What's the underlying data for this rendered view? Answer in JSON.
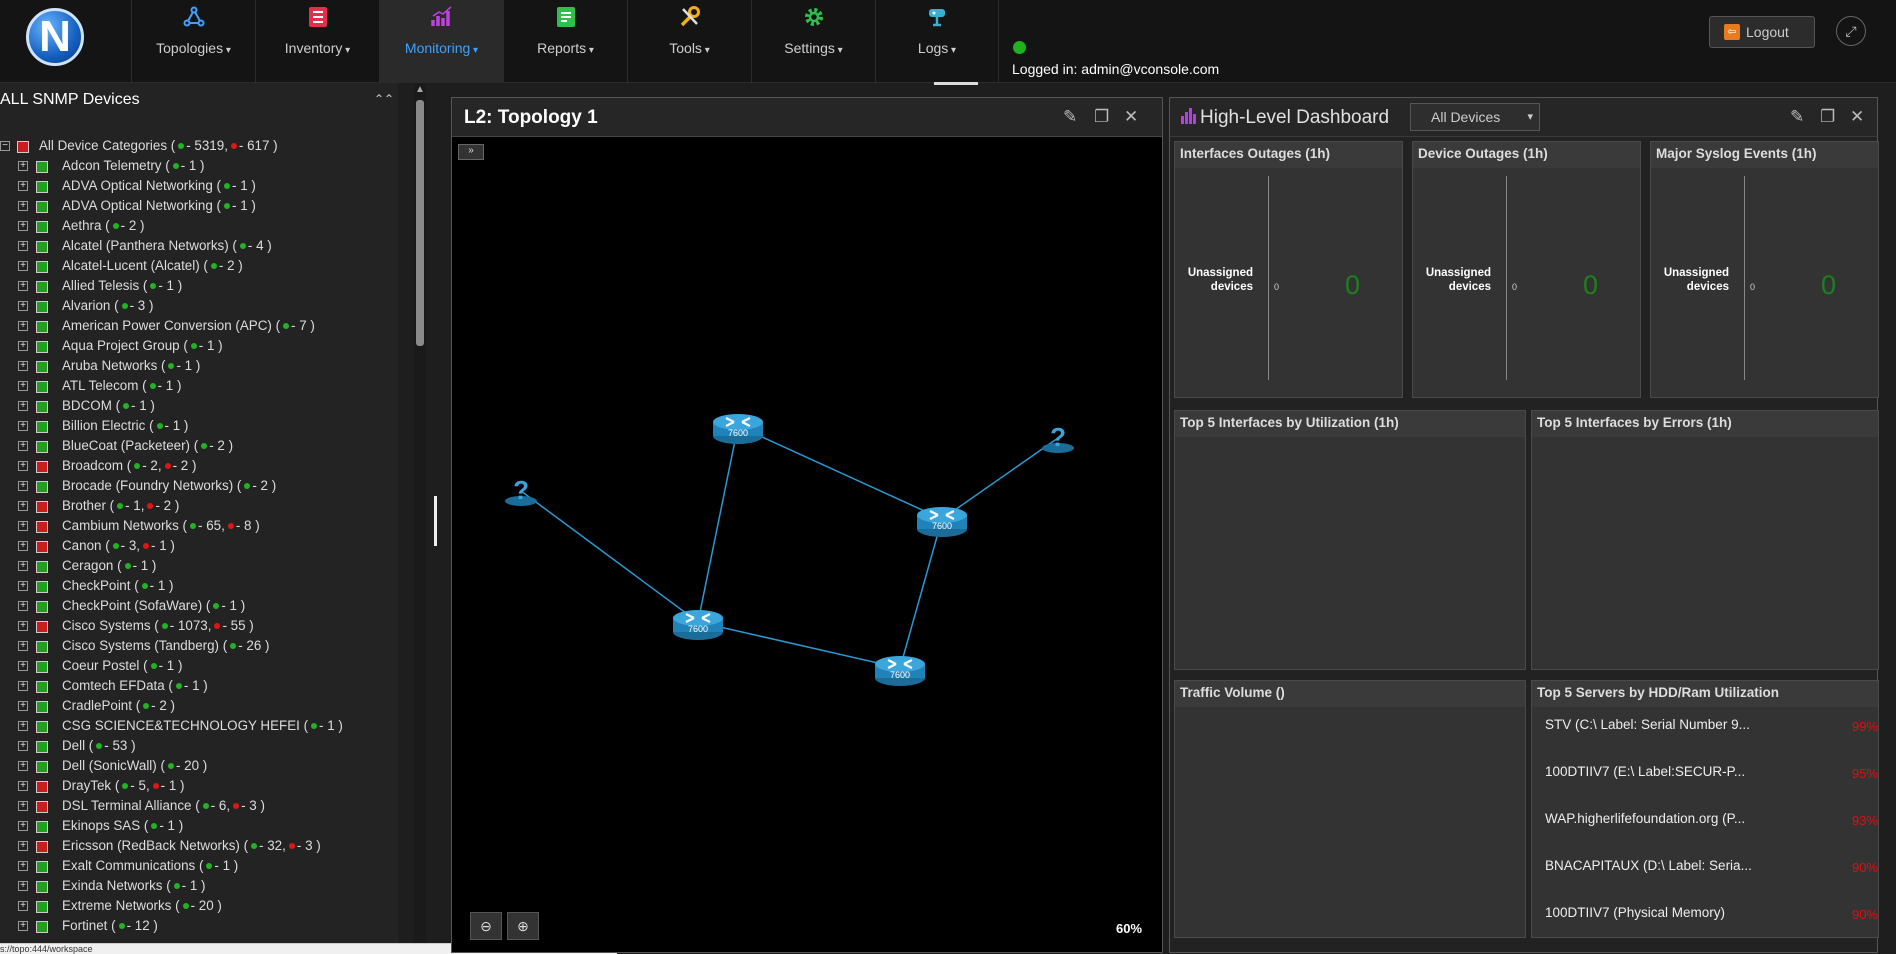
{
  "nav": {
    "items": [
      {
        "label": "Topologies",
        "icon": "topology-icon",
        "color": "#3ea1ff"
      },
      {
        "label": "Inventory",
        "icon": "inventory-icon",
        "color": "#e0304a"
      },
      {
        "label": "Monitoring",
        "icon": "monitoring-icon",
        "color": "#c040e0"
      },
      {
        "label": "Reports",
        "icon": "reports-icon",
        "color": "#2ec04a"
      },
      {
        "label": "Tools",
        "icon": "tools-icon",
        "color": "#f0b010"
      },
      {
        "label": "Settings",
        "icon": "settings-icon",
        "color": "#2ec04a"
      },
      {
        "label": "Logs",
        "icon": "logs-icon",
        "color": "#3ab0d0"
      }
    ],
    "active": "Monitoring",
    "logged_in": "Logged in: admin@vconsole.com",
    "logout": "Logout",
    "logo_letter": "N"
  },
  "devices": {
    "title": "ALL SNMP Devices",
    "root": {
      "label": "All Device Categories",
      "green": "5319",
      "red": "617"
    },
    "items": [
      {
        "label": "Adcon Telemetry",
        "green": "1"
      },
      {
        "label": "ADVA Optical Networking",
        "green": "1"
      },
      {
        "label": "ADVA Optical Networking",
        "green": "1"
      },
      {
        "label": "Aethra",
        "green": "2"
      },
      {
        "label": "Alcatel (Panthera Networks)",
        "green": "4"
      },
      {
        "label": "Alcatel-Lucent (Alcatel)",
        "green": "2"
      },
      {
        "label": "Allied Telesis",
        "green": "1"
      },
      {
        "label": "Alvarion",
        "green": "3"
      },
      {
        "label": "American Power Conversion (APC)",
        "green": "7"
      },
      {
        "label": "Aqua Project Group",
        "green": "1"
      },
      {
        "label": "Aruba Networks",
        "green": "1"
      },
      {
        "label": "ATL Telecom",
        "green": "1"
      },
      {
        "label": "BDCOM",
        "green": "1"
      },
      {
        "label": "Billion Electric",
        "green": "1"
      },
      {
        "label": "BlueCoat (Packeteer)",
        "green": "2"
      },
      {
        "label": "Broadcom",
        "green": "2",
        "red": "2"
      },
      {
        "label": "Brocade (Foundry Networks)",
        "green": "2"
      },
      {
        "label": "Brother",
        "green": "1",
        "red": "2"
      },
      {
        "label": "Cambium Networks",
        "green": "65",
        "red": "8"
      },
      {
        "label": "Canon",
        "green": "3",
        "red": "1"
      },
      {
        "label": "Ceragon",
        "green": "1"
      },
      {
        "label": "CheckPoint",
        "green": "1"
      },
      {
        "label": "CheckPoint (SofaWare)",
        "green": "1"
      },
      {
        "label": "Cisco Systems",
        "green": "1073",
        "red": "55"
      },
      {
        "label": "Cisco Systems (Tandberg)",
        "green": "26"
      },
      {
        "label": "Coeur Postel",
        "green": "1"
      },
      {
        "label": "Comtech EFData",
        "green": "1"
      },
      {
        "label": "CradlePoint",
        "green": "2"
      },
      {
        "label": "CSG SCIENCE&TECHNOLOGY HEFEI",
        "green": "1"
      },
      {
        "label": "Dell",
        "green": "53"
      },
      {
        "label": "Dell (SonicWall)",
        "green": "20"
      },
      {
        "label": "DrayTek",
        "green": "5",
        "red": "1"
      },
      {
        "label": "DSL Terminal Alliance",
        "green": "6",
        "red": "3"
      },
      {
        "label": "Ekinops SAS",
        "green": "1"
      },
      {
        "label": "Ericsson (RedBack Networks)",
        "green": "32",
        "red": "3"
      },
      {
        "label": "Exalt Communications",
        "green": "1"
      },
      {
        "label": "Exinda Networks",
        "green": "1"
      },
      {
        "label": "Extreme Networks",
        "green": "20"
      },
      {
        "label": "Fortinet",
        "green": "12"
      }
    ]
  },
  "status_url": "s://topo:444/workspace",
  "topology": {
    "title": "L2: Topology 1",
    "zoom": "60%",
    "expand": "»",
    "model_label": "7600"
  },
  "dashboard": {
    "title": "High-Level Dashboard",
    "filter": "All Devices",
    "cards": {
      "interfaces_outages": "Interfaces Outages (1h)",
      "device_outages": "Device Outages (1h)",
      "major_syslog": "Major Syslog Events (1h)",
      "top5_util": "Top 5 Interfaces by Utilization (1h)",
      "top5_errors": "Top 5 Interfaces by Errors (1h)",
      "traffic_volume": "Traffic Volume ()",
      "top5_servers": "Top 5 Servers by HDD/Ram Utilization"
    },
    "outage": {
      "label": "Unassigned devices",
      "axis_zero": "0",
      "value": "0"
    },
    "servers": [
      {
        "name": "STV (C:\\ Label: Serial Number 9...",
        "pct": "99%"
      },
      {
        "name": "100DTIIV7 (E:\\ Label:SECUR-P...",
        "pct": "95%"
      },
      {
        "name": "WAP.higherlifefoundation.org (P...",
        "pct": "93%"
      },
      {
        "name": "BNACAPITAUX (D:\\ Label: Seria...",
        "pct": "90%"
      },
      {
        "name": "100DTIIV7 (Physical Memory)",
        "pct": "90%"
      }
    ]
  }
}
